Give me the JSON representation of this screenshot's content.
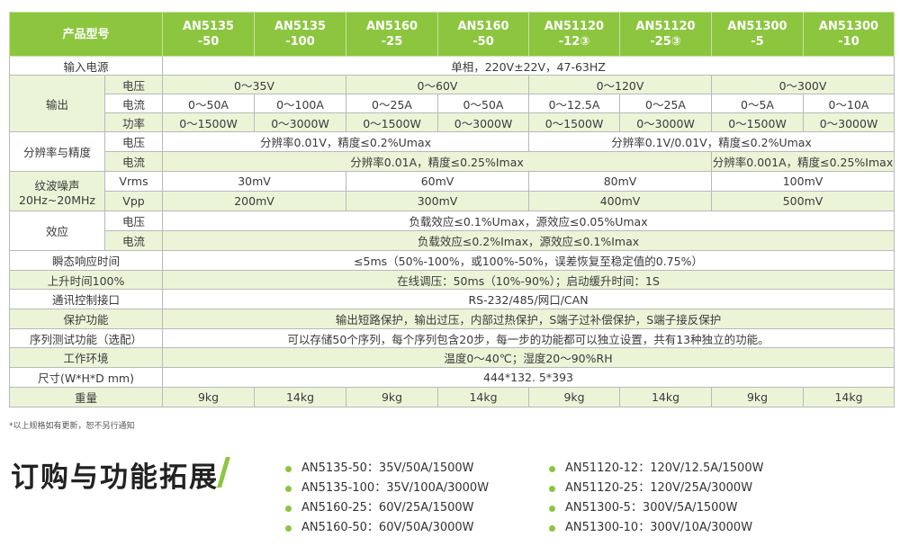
{
  "table": {
    "header": {
      "label": "产品型号",
      "models": [
        [
          "AN5135",
          "-50"
        ],
        [
          "AN5135",
          "-100"
        ],
        [
          "AN5160",
          "-25"
        ],
        [
          "AN5160",
          "-50"
        ],
        [
          "AN51120",
          "-12③"
        ],
        [
          "AN51120",
          "-25③"
        ],
        [
          "AN51300",
          "-5"
        ],
        [
          "AN51300",
          "-10"
        ]
      ]
    },
    "input_power": {
      "label": "输入电源",
      "value": "单相，220V±22V，47-63HZ"
    },
    "output": {
      "label": "输出",
      "voltage_label": "电压",
      "current_label": "电流",
      "power_label": "功率",
      "voltage": [
        "0～35V",
        "0～60V",
        "0～120V",
        "0～300V"
      ],
      "current": [
        "0～50A",
        "0～100A",
        "0～25A",
        "0～50A",
        "0～12.5A",
        "0～25A",
        "0～5A",
        "0～10A"
      ],
      "power": [
        "0～1500W",
        "0～3000W",
        "0～1500W",
        "0～3000W",
        "0～1500W",
        "0～3000W",
        "0～1500W",
        "0～3000W"
      ]
    },
    "resolution": {
      "label": "分辨率与精度",
      "voltage_label": "电压",
      "current_label": "电流",
      "voltage": [
        "分辨率0.01V，精度≤0.2%Umax",
        "分辨率0.1V/0.01V，精度≤0.2%Umax"
      ],
      "current": [
        "分辨率0.01A，精度≤0.25%Imax",
        "分辨率0.001A，精度≤0.25%Imax"
      ]
    },
    "ripple": {
      "label_1": "纹波噪声",
      "label_2": "20Hz~20MHz",
      "vrms_label": "Vrms",
      "vpp_label": "Vpp",
      "vrms": [
        "30mV",
        "60mV",
        "80mV",
        "100mV"
      ],
      "vpp": [
        "200mV",
        "300mV",
        "400mV",
        "500mV"
      ]
    },
    "regulation": {
      "label": "效应",
      "voltage_label": "电压",
      "current_label": "电流",
      "voltage": "负载效应≤0.1%Umax，源效应≤0.05%Umax",
      "current": "负载效应≤0.2%Imax，源效应≤0.1%Imax"
    },
    "transient": {
      "label": "瞬态响应时间",
      "value": "≤5ms（50%-100%，或100%-50%，误差恢复至稳定值的0.75%）"
    },
    "rise_time": {
      "label": "上升时间100%",
      "value": "在线调压：50ms（10%-90%）；启动缓升时间：1S"
    },
    "interface": {
      "label": "通讯控制接口",
      "value": "RS-232/485/网口/CAN"
    },
    "protection": {
      "label": "保护功能",
      "value": "输出短路保护，输出过压，内部过热保护，S端子过补偿保护，S端子接反保护"
    },
    "sequence": {
      "label": "序列测试功能（选配）",
      "value": "可以存储50个序列，每个序列包含20步，每一步的功能都可以独立设置，共有13种独立的功能。"
    },
    "environment": {
      "label": "工作环境",
      "value": "温度0～40℃；湿度20～90%RH"
    },
    "size": {
      "label": "尺寸(W*H*D mm)",
      "value": "444*132. 5*393"
    },
    "weight": {
      "label": "重量",
      "values": [
        "9kg",
        "14kg",
        "9kg",
        "14kg",
        "9kg",
        "14kg",
        "9kg",
        "14kg"
      ]
    }
  },
  "note": "*以上规格如有更新，恕不另行通知",
  "ordering": {
    "title": "订购与功能拓展",
    "col1": [
      "AN5135-50：35V/50A/1500W",
      "AN5135-100：35V/100A/3000W",
      "AN5160-25：60V/25A/1500W",
      "AN5160-50：60V/50A/3000W"
    ],
    "col2": [
      "AN51120-12：120V/12.5A/1500W",
      "AN51120-25：120V/25A/3000W",
      "AN51300-5：300V/5A/1500W",
      "AN51300-10：300V/10A/3000W"
    ]
  },
  "colors": {
    "accent": "#8cc63f",
    "light_row": "#ecf4d8"
  }
}
